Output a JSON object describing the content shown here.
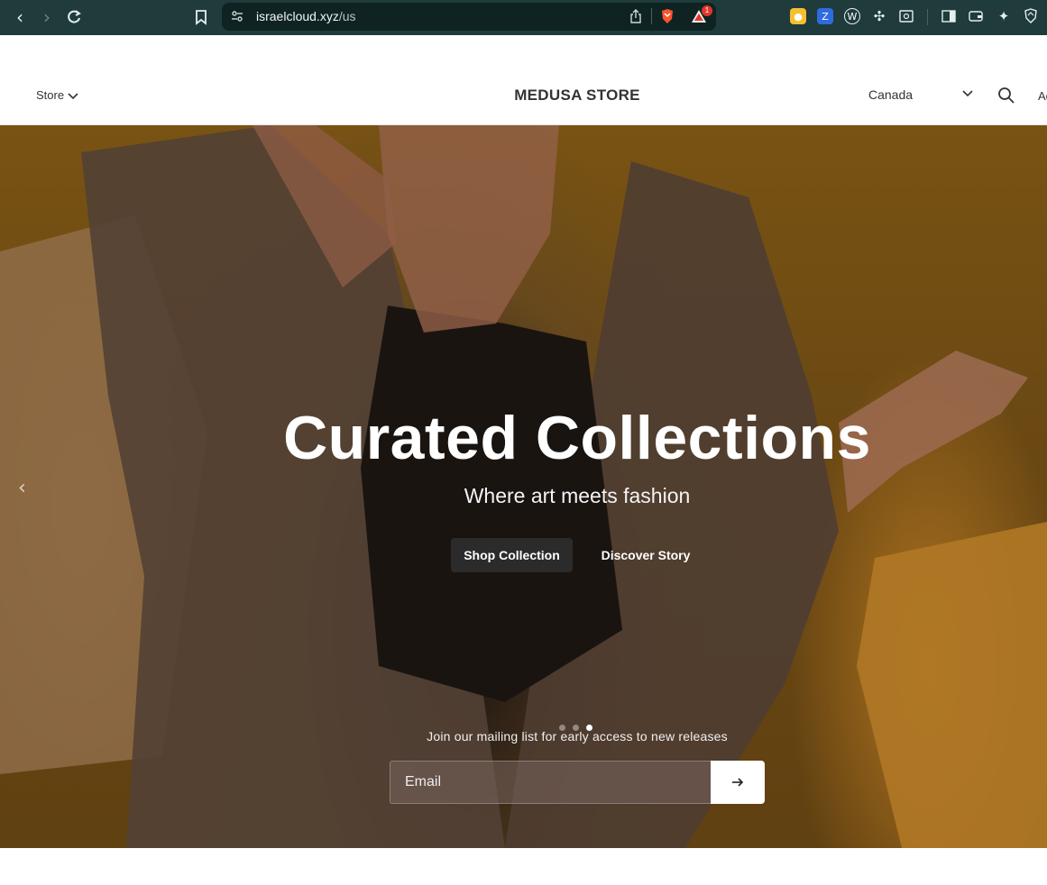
{
  "browser": {
    "url_domain": "israelcloud.xyz",
    "url_path": "/us",
    "notification_count": "1",
    "icons": [
      "back-icon",
      "forward-icon",
      "reload-icon",
      "bookmark-icon",
      "site-info-icon",
      "share-icon",
      "brave-shield-icon",
      "brave-rewards-icon",
      "extensions-icon",
      "sidebar-icon",
      "wallet-icon",
      "leo-ai-icon",
      "vpn-icon"
    ]
  },
  "header": {
    "store_menu_label": "Store",
    "title": "MEDUSA STORE",
    "country": "Canada",
    "account_label_partial": "Ac"
  },
  "hero": {
    "title": "Curated Collections",
    "subtitle": "Where art meets fashion",
    "primary_cta": "Shop Collection",
    "secondary_cta": "Discover Story",
    "slide_count": 3,
    "active_slide": 3
  },
  "newsletter": {
    "label": "Join our mailing list for early access to new releases",
    "email_placeholder": "Email",
    "submit_icon": "arrow-right-icon"
  }
}
